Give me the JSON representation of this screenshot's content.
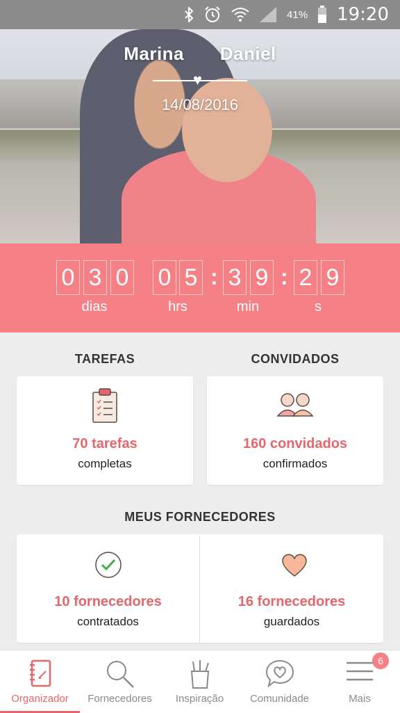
{
  "status_bar": {
    "battery": "41%",
    "time": "19:20"
  },
  "hero": {
    "name1": "Marina",
    "name2": "Daniel",
    "date": "14/08/2016"
  },
  "countdown": {
    "days": [
      "0",
      "3",
      "0"
    ],
    "hours": [
      "0",
      "5"
    ],
    "minutes": [
      "3",
      "9"
    ],
    "seconds": [
      "2",
      "9"
    ],
    "labels": {
      "days": "dias",
      "hours": "hrs",
      "minutes": "min",
      "seconds": "s"
    }
  },
  "tasks": {
    "title": "TAREFAS",
    "count": "70 tarefas",
    "sub": "completas"
  },
  "guests": {
    "title": "CONVIDADOS",
    "count": "160 convidados",
    "sub": "confirmados"
  },
  "vendors": {
    "title": "MEUS FORNECEDORES",
    "hired": {
      "count": "10 fornecedores",
      "sub": "contratados"
    },
    "saved": {
      "count": "16 fornecedores",
      "sub": "guardados"
    }
  },
  "tabs": [
    {
      "label": "Organizador",
      "icon": "notebook-icon"
    },
    {
      "label": "Fornecedores",
      "icon": "search-icon"
    },
    {
      "label": "Inspiração",
      "icon": "pencil-cup-icon"
    },
    {
      "label": "Comunidade",
      "icon": "chat-heart-icon"
    },
    {
      "label": "Mais",
      "icon": "menu-icon"
    }
  ],
  "more_badge": "6",
  "colors": {
    "accent": "#f58086",
    "accent_text": "#e5666b"
  }
}
